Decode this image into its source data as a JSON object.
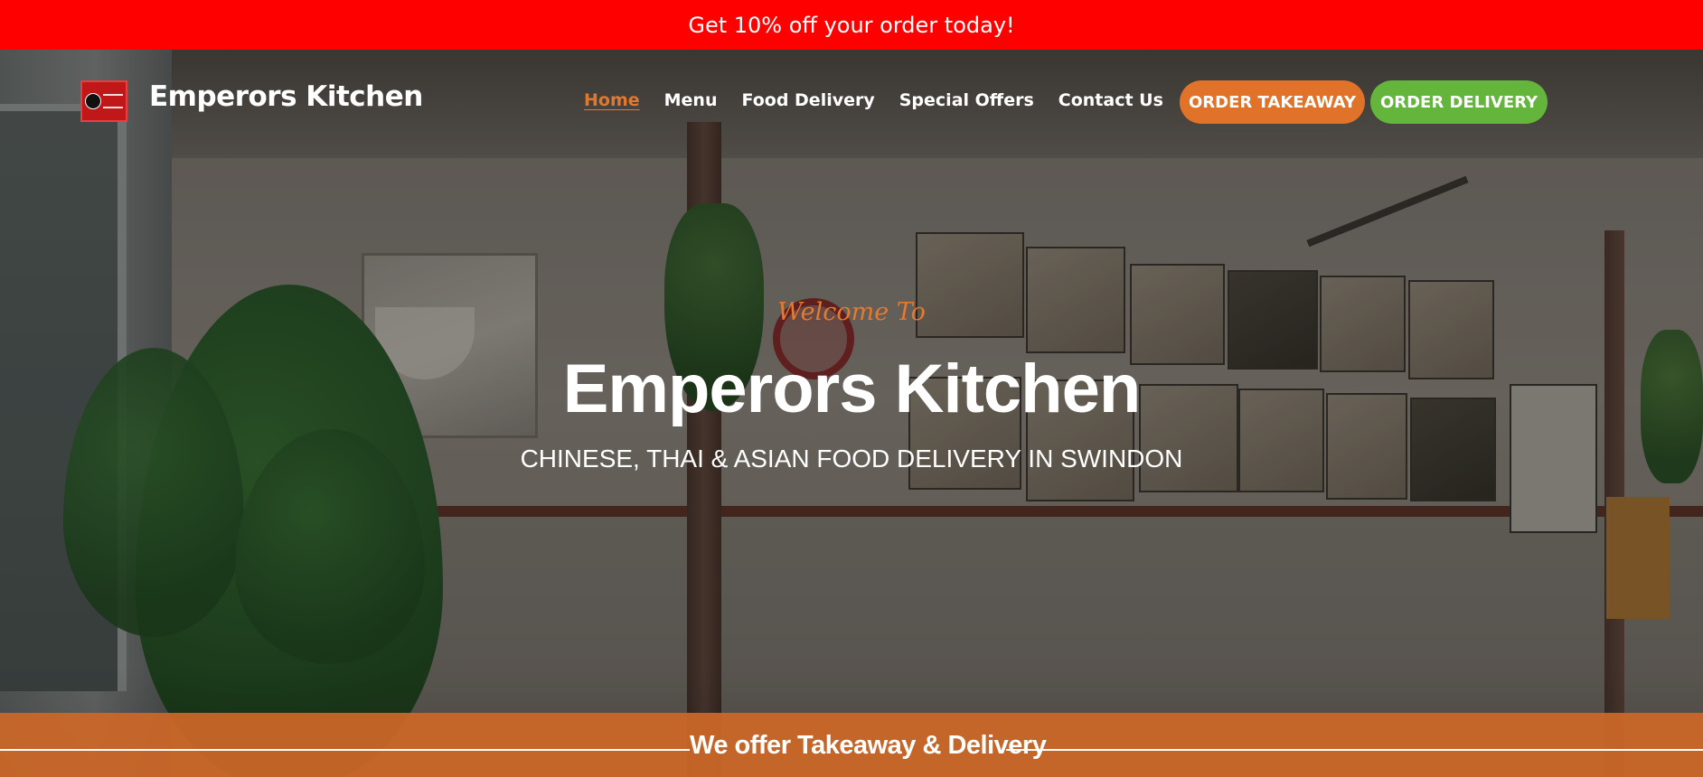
{
  "promo": {
    "text": "Get 10% off your order today!"
  },
  "header": {
    "brand": "Emperors Kitchen",
    "nav": [
      {
        "label": "Home",
        "active": true
      },
      {
        "label": "Menu"
      },
      {
        "label": "Food Delivery"
      },
      {
        "label": "Special Offers"
      },
      {
        "label": "Contact Us"
      }
    ],
    "buttons": {
      "takeaway": "ORDER TAKEAWAY",
      "delivery": "ORDER DELIVERY"
    }
  },
  "hero": {
    "welcome": "Welcome To",
    "title": "Emperors Kitchen",
    "subtitle": "CHINESE, THAI & ASIAN FOOD DELIVERY IN SWINDON"
  },
  "offer": {
    "text": "We offer Takeaway & Delivery"
  },
  "colors": {
    "promo_bg": "#ff0000",
    "accent_orange": "#e0722a",
    "accent_green": "#63b53c",
    "nav_active": "#e1782f"
  }
}
